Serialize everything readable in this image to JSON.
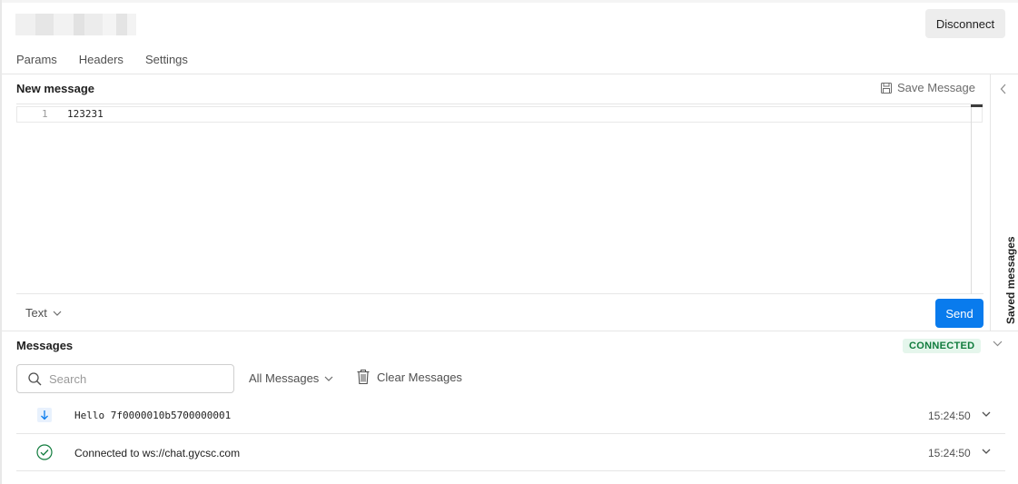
{
  "header": {
    "disconnect_label": "Disconnect"
  },
  "tabs": [
    {
      "label": "Params"
    },
    {
      "label": "Headers"
    },
    {
      "label": "Settings"
    }
  ],
  "new_message": {
    "title": "New message",
    "save_label": "Save Message",
    "editor": {
      "line_number": "1",
      "content": "123231"
    },
    "type_label": "Text",
    "send_label": "Send"
  },
  "side_panel": {
    "label": "Saved messages"
  },
  "messages": {
    "title": "Messages",
    "status": "CONNECTED",
    "status_color": "#0f7b3c",
    "search_placeholder": "Search",
    "filter_label": "All Messages",
    "clear_label": "Clear Messages",
    "items": [
      {
        "type": "incoming",
        "icon": "arrow-down-icon",
        "text": "Hello 7f0000010b5700000001",
        "time": "15:24:50"
      },
      {
        "type": "connected",
        "icon": "check-circle-icon",
        "text": "Connected to ws://chat.gycsc.com",
        "time": "15:24:50"
      }
    ]
  },
  "colors": {
    "accent": "#097bed",
    "connected_bg": "#e5f6ec"
  }
}
